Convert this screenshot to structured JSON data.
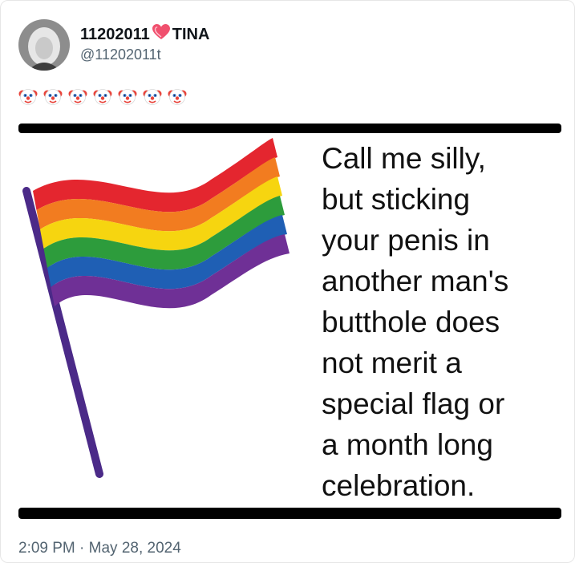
{
  "tweet": {
    "display_name": "11202011",
    "name_suffix": "TINA",
    "handle": "@11202011t",
    "emoji_count": 7,
    "meme_text": "Call me silly,\nbut sticking\nyour penis in\nanother man's\nbutthole does\nnot merit a\nspecial flag or\na month long\ncelebration.",
    "time": "2:09 PM",
    "separator": "·",
    "date": "May 28, 2024"
  },
  "icons": {
    "name_badge": "heart-icon",
    "emoji": "clown-face-icon"
  },
  "colors": {
    "heart": "#f0506e",
    "text_primary": "#0f1419",
    "text_secondary": "#536471",
    "flag_pole": "#4b2a88",
    "flag_stripes": [
      "#e4262f",
      "#f27c20",
      "#f6d510",
      "#2d9c3c",
      "#1f5fb4",
      "#6f3096"
    ]
  }
}
